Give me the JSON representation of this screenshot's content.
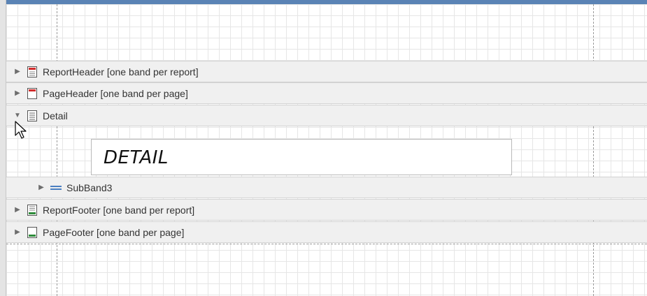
{
  "bands": {
    "report_header": {
      "label": "ReportHeader [one band per report]",
      "icon": "report-header-icon",
      "expanded": false
    },
    "page_header": {
      "label": "PageHeader [one band per page]",
      "icon": "page-header-icon",
      "expanded": false
    },
    "detail": {
      "label": "Detail",
      "icon": "detail-band-icon",
      "expanded": true
    },
    "sub_band": {
      "label": "SubBand3",
      "icon": "subband-icon",
      "expanded": false
    },
    "report_footer": {
      "label": "ReportFooter [one band per report]",
      "icon": "report-footer-icon",
      "expanded": false
    },
    "page_footer": {
      "label": "PageFooter [one band per page]",
      "icon": "page-footer-icon",
      "expanded": false
    }
  },
  "detail_label": {
    "text": "DETAIL"
  },
  "colors": {
    "accent": "#5a83b5",
    "header_marker": "#d12b2b",
    "footer_marker": "#2e8b3a",
    "subband_marker": "#4a7fc1"
  }
}
